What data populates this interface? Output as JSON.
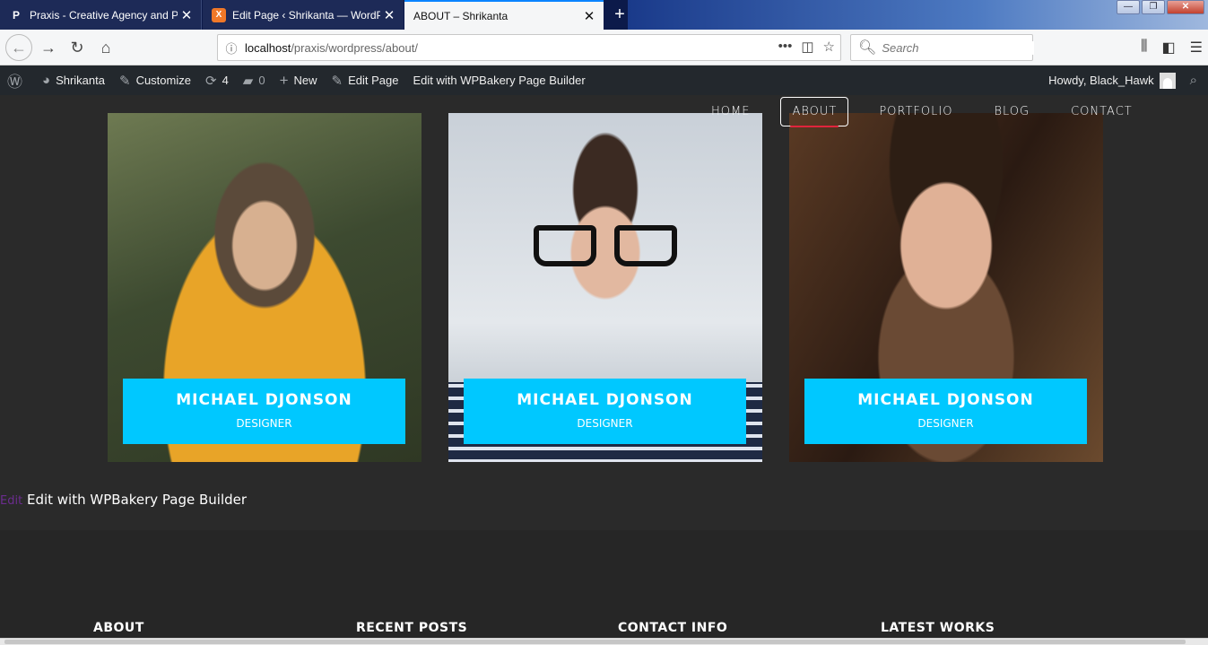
{
  "browser": {
    "tabs": [
      {
        "title": "Praxis - Creative Agency and Po",
        "favicon": "P"
      },
      {
        "title": "Edit Page ‹ Shrikanta — WordP",
        "favicon": "X"
      },
      {
        "title": "ABOUT – Shrikanta",
        "favicon": ""
      }
    ],
    "new_tab": "+",
    "url_host": "localhost",
    "url_path": "/praxis/wordpress/about/",
    "search_placeholder": "Search"
  },
  "adminbar": {
    "site": "Shrikanta",
    "customize": "Customize",
    "updates": "4",
    "comments": "0",
    "new": "New",
    "edit_page": "Edit Page",
    "wpbakery": "Edit with WPBakery Page Builder",
    "howdy": "Howdy, Black_Hawk"
  },
  "nav": {
    "items": [
      "HOME",
      "ABOUT",
      "PORTFOLIO",
      "BLOG",
      "CONTACT"
    ],
    "active": "ABOUT"
  },
  "team": [
    {
      "name": "MICHAEL DJONSON",
      "role": "DESIGNER"
    },
    {
      "name": "MICHAEL DJONSON",
      "role": "DESIGNER"
    },
    {
      "name": "MICHAEL DJONSON",
      "role": "DESIGNER"
    }
  ],
  "edit_line": {
    "edit": "Edit",
    "builder": "Edit with WPBakery Page Builder"
  },
  "footer": {
    "about": "ABOUT",
    "recent_posts": "RECENT POSTS",
    "contact_info": "CONTACT INFO",
    "latest_works": "LATEST WORKS"
  },
  "colors": {
    "accent": "#00c8ff",
    "active_underline": "#e0243c",
    "adminbar": "#23282d",
    "page_bg": "#2a2a2a"
  }
}
